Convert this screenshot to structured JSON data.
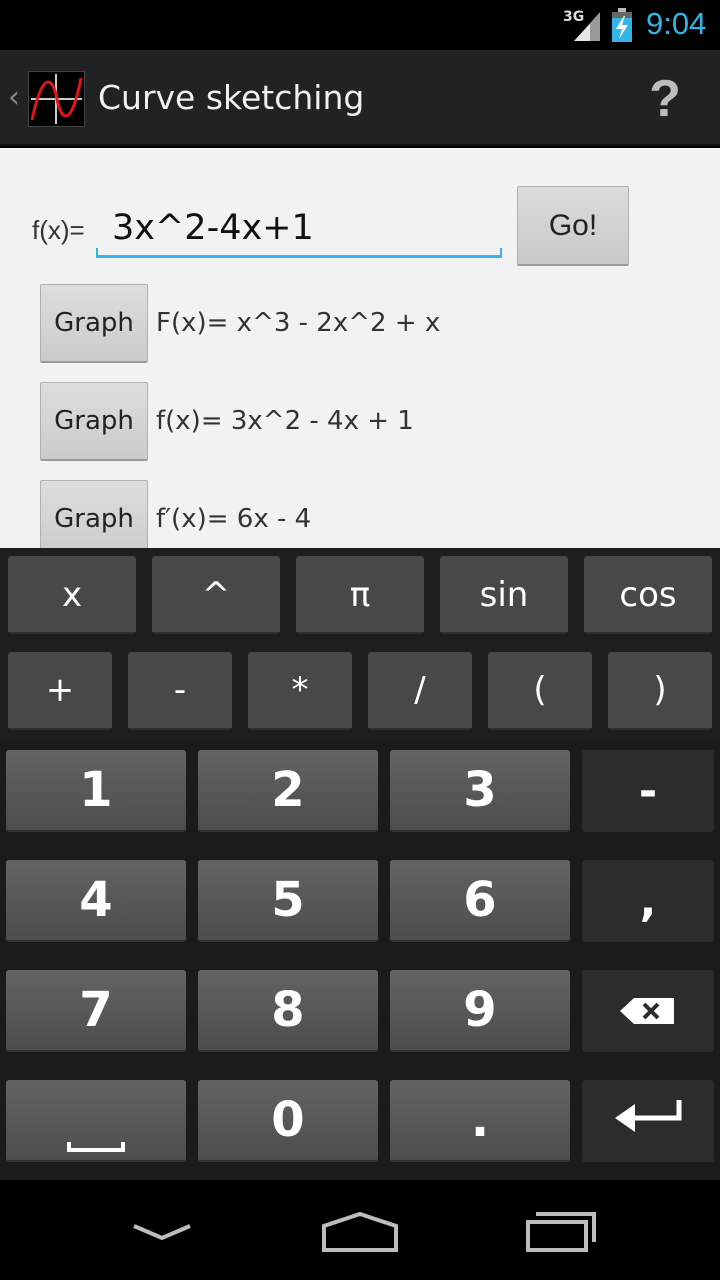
{
  "status_bar": {
    "network": "3G",
    "time": "9:04",
    "accent_color": "#33b5e5"
  },
  "action_bar": {
    "back_icon": "chevron-left-icon",
    "app_icon": "curve-graph-icon",
    "title": "Curve sketching",
    "help_label": "?"
  },
  "function_input": {
    "label": "f(x)=",
    "value": "3x^2-4x+1",
    "go_label": "Go!"
  },
  "results": [
    {
      "button": "Graph",
      "formula": "F(x)= x^3 - 2x^2 + x"
    },
    {
      "button": "Graph",
      "formula": "f(x)= 3x^2 - 4x + 1"
    },
    {
      "button": "Graph",
      "formula": "f′(x)= 6x - 4"
    }
  ],
  "keyboard": {
    "row1": [
      "x",
      "^",
      "π",
      "sin",
      "cos"
    ],
    "row2": [
      "+",
      "-",
      "*",
      "/",
      "(",
      ")"
    ],
    "num_rows": [
      [
        "1",
        "2",
        "3",
        "-"
      ],
      [
        "4",
        "5",
        "6",
        ","
      ],
      [
        "7",
        "8",
        "9"
      ],
      [
        "0",
        "."
      ]
    ],
    "special_keys": [
      "space-icon",
      "backspace-icon",
      "enter-icon"
    ]
  },
  "nav_bar": {
    "icons": [
      "back-icon",
      "home-icon",
      "recent-apps-icon"
    ]
  }
}
